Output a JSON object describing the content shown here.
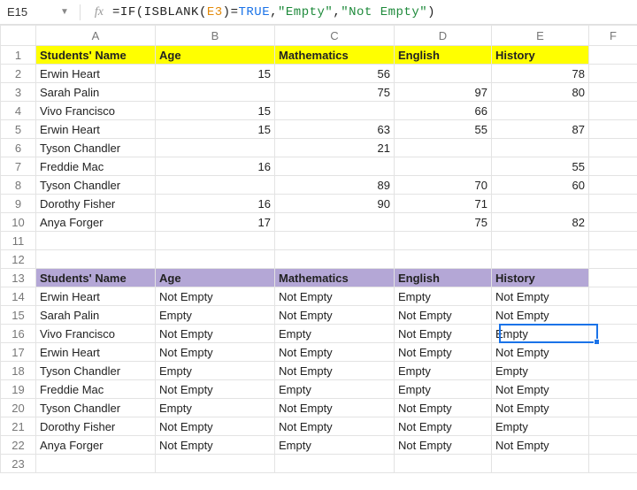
{
  "nameBox": "E15",
  "formula_parts": {
    "p1": "=",
    "p2": "IF",
    "p3": "(",
    "p4": "ISBLANK",
    "p5": "(",
    "ref": "E3",
    "p6": ")=",
    "kw": "TRUE",
    "p7": ",",
    "s1": "\"Empty\"",
    "p8": ",",
    "s2": "\"Not Empty\"",
    "p9": ")"
  },
  "colHeaders": {
    "A": "A",
    "B": "B",
    "C": "C",
    "D": "D",
    "E": "E",
    "F": "F"
  },
  "rowLabels": [
    "1",
    "2",
    "3",
    "4",
    "5",
    "6",
    "7",
    "8",
    "9",
    "10",
    "11",
    "12",
    "13",
    "14",
    "15",
    "16",
    "17",
    "18",
    "19",
    "20",
    "21",
    "22",
    "23"
  ],
  "headers1": {
    "name": "Students' Name",
    "age": "Age",
    "math": "Mathematics",
    "eng": "English",
    "hist": "History"
  },
  "headers2": {
    "name": "Students' Name",
    "age": "Age",
    "math": "Mathematics",
    "eng": "English",
    "hist": "History"
  },
  "students": [
    {
      "name": "Erwin Heart",
      "age": "15",
      "math": "56",
      "eng": "",
      "hist": "78"
    },
    {
      "name": "Sarah Palin",
      "age": "",
      "math": "75",
      "eng": "97",
      "hist": "80"
    },
    {
      "name": "Vivo Francisco",
      "age": "15",
      "math": "",
      "eng": "66",
      "hist": ""
    },
    {
      "name": "Erwin Heart",
      "age": "15",
      "math": "63",
      "eng": "55",
      "hist": "87"
    },
    {
      "name": "Tyson Chandler",
      "age": "",
      "math": "21",
      "eng": "",
      "hist": ""
    },
    {
      "name": "Freddie Mac",
      "age": "16",
      "math": "",
      "eng": "",
      "hist": "55"
    },
    {
      "name": "Tyson Chandler",
      "age": "",
      "math": "89",
      "eng": "70",
      "hist": "60"
    },
    {
      "name": "Dorothy Fisher",
      "age": "16",
      "math": "90",
      "eng": "71",
      "hist": ""
    },
    {
      "name": "Anya Forger",
      "age": "17",
      "math": "",
      "eng": "75",
      "hist": "82"
    }
  ],
  "checks": [
    {
      "name": "Erwin Heart",
      "age": "Not Empty",
      "math": "Not Empty",
      "eng": "Empty",
      "hist": "Not Empty"
    },
    {
      "name": "Sarah Palin",
      "age": "Empty",
      "math": "Not Empty",
      "eng": "Not Empty",
      "hist": "Not Empty"
    },
    {
      "name": "Vivo Francisco",
      "age": "Not Empty",
      "math": "Empty",
      "eng": "Not Empty",
      "hist": "Empty"
    },
    {
      "name": "Erwin Heart",
      "age": "Not Empty",
      "math": "Not Empty",
      "eng": "Not Empty",
      "hist": "Not Empty"
    },
    {
      "name": "Tyson Chandler",
      "age": "Empty",
      "math": "Not Empty",
      "eng": "Empty",
      "hist": "Empty"
    },
    {
      "name": "Freddie Mac",
      "age": "Not Empty",
      "math": "Empty",
      "eng": "Empty",
      "hist": "Not Empty"
    },
    {
      "name": "Tyson Chandler",
      "age": "Empty",
      "math": "Not Empty",
      "eng": "Not Empty",
      "hist": "Not Empty"
    },
    {
      "name": "Dorothy Fisher",
      "age": "Not Empty",
      "math": "Not Empty",
      "eng": "Not Empty",
      "hist": "Empty"
    },
    {
      "name": "Anya Forger",
      "age": "Not Empty",
      "math": "Empty",
      "eng": "Not Empty",
      "hist": "Not Empty"
    }
  ]
}
